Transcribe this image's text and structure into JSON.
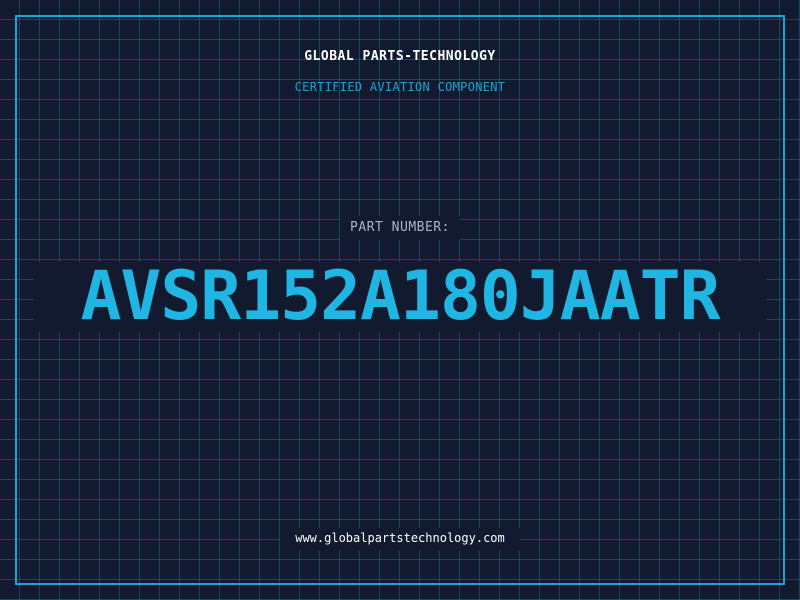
{
  "header": {
    "company_name": "GLOBAL PARTS-TECHNOLOGY",
    "subtitle": "CERTIFIED AVIATION COMPONENT"
  },
  "part": {
    "label": "PART NUMBER:",
    "number": "AVSR152A180JAATR"
  },
  "footer": {
    "website": "www.globalpartstechnology.com"
  },
  "colors": {
    "background": "#111a2e",
    "grid": "#1f6884",
    "accent": "#1aa3d4",
    "part_number": "#1fb6e3",
    "label": "#aab4c4",
    "text": "#ffffff"
  }
}
